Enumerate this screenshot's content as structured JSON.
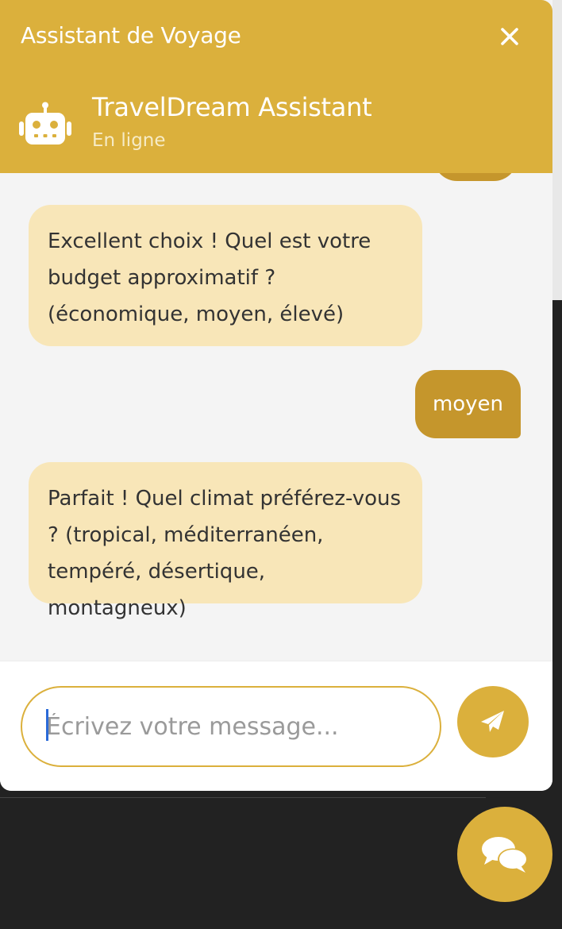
{
  "header": {
    "title": "Assistant de Voyage",
    "bot_name": "TravelDream Assistant",
    "bot_status": "En ligne",
    "close_icon": "close-icon",
    "avatar_icon": "robot-icon"
  },
  "messages": [
    {
      "from": "bot",
      "text": "Excellent choix ! Quel est votre budget approximatif ? (économique, moyen, élevé)"
    },
    {
      "from": "user",
      "text": "moyen"
    },
    {
      "from": "bot",
      "text": "Parfait ! Quel climat préférez-vous ? (tropical, méditerranéen, tempéré, désertique, montagneux)"
    }
  ],
  "composer": {
    "placeholder": "Écrivez votre message...",
    "value": "",
    "send_icon": "paper-plane-icon"
  },
  "launcher": {
    "icon": "chat-bubbles-icon"
  },
  "colors": {
    "accent": "#dbb03c",
    "user_bubble": "#c5962c",
    "bot_bubble": "#f8e6b8",
    "chat_background": "#f4f4f4",
    "page_background": "#222222"
  }
}
